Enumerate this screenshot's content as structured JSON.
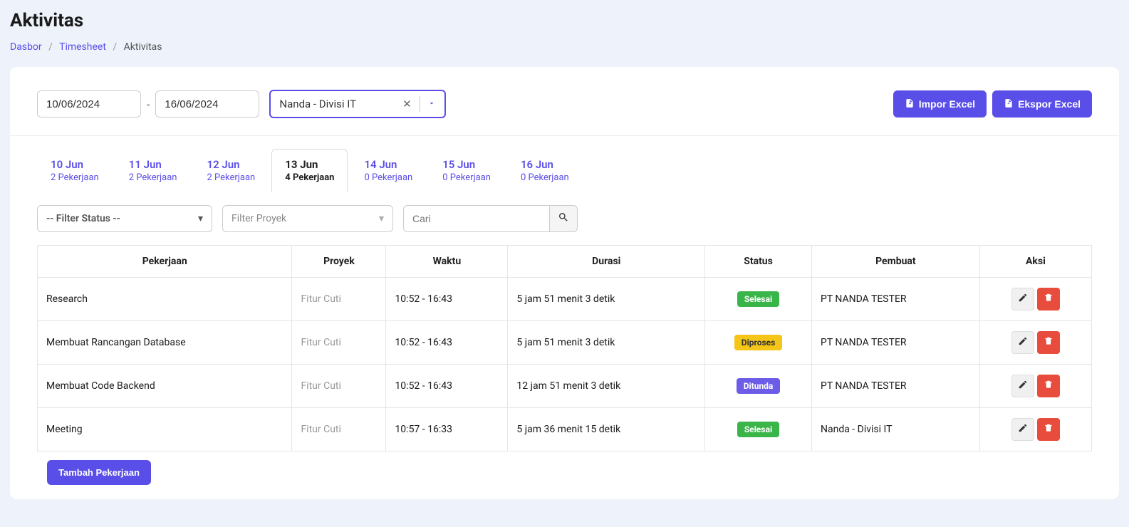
{
  "page": {
    "title": "Aktivitas"
  },
  "breadcrumb": {
    "items": [
      "Dasbor",
      "Timesheet",
      "Aktivitas"
    ]
  },
  "toolbar": {
    "date_from": "10/06/2024",
    "date_to": "16/06/2024",
    "person": "Nanda - Divisi IT",
    "import_label": "Impor Excel",
    "export_label": "Ekspor Excel"
  },
  "tabs": [
    {
      "date": "10 Jun",
      "count": "2 Pekerjaan",
      "active": false
    },
    {
      "date": "11 Jun",
      "count": "2 Pekerjaan",
      "active": false
    },
    {
      "date": "12 Jun",
      "count": "2 Pekerjaan",
      "active": false
    },
    {
      "date": "13 Jun",
      "count": "4 Pekerjaan",
      "active": true
    },
    {
      "date": "14 Jun",
      "count": "0 Pekerjaan",
      "active": false
    },
    {
      "date": "15 Jun",
      "count": "0 Pekerjaan",
      "active": false
    },
    {
      "date": "16 Jun",
      "count": "0 Pekerjaan",
      "active": false
    }
  ],
  "filters": {
    "status_placeholder": "-- Filter Status --",
    "proyek_placeholder": "Filter Proyek",
    "search_placeholder": "Cari"
  },
  "table": {
    "headers": [
      "Pekerjaan",
      "Proyek",
      "Waktu",
      "Durasi",
      "Status",
      "Pembuat",
      "Aksi"
    ],
    "rows": [
      {
        "pekerjaan": "Research",
        "proyek": "Fitur Cuti",
        "waktu": "10:52 - 16:43",
        "durasi": "5 jam 51 menit 3 detik",
        "status": "Selesai",
        "status_class": "badge-green",
        "pembuat": "PT NANDA TESTER"
      },
      {
        "pekerjaan": "Membuat Rancangan Database",
        "proyek": "Fitur Cuti",
        "waktu": "10:52 - 16:43",
        "durasi": "5 jam 51 menit 3 detik",
        "status": "Diproses",
        "status_class": "badge-yellow",
        "pembuat": "PT NANDA TESTER"
      },
      {
        "pekerjaan": "Membuat Code Backend",
        "proyek": "Fitur Cuti",
        "waktu": "10:52 - 16:43",
        "durasi": "12 jam 51 menit 3 detik",
        "status": "Ditunda",
        "status_class": "badge-purple",
        "pembuat": "PT NANDA TESTER"
      },
      {
        "pekerjaan": "Meeting",
        "proyek": "Fitur Cuti",
        "waktu": "10:57 - 16:33",
        "durasi": "5 jam 36 menit 15 detik",
        "status": "Selesai",
        "status_class": "badge-green",
        "pembuat": "Nanda - Divisi IT"
      }
    ]
  },
  "add_button": "Tambah Pekerjaan"
}
